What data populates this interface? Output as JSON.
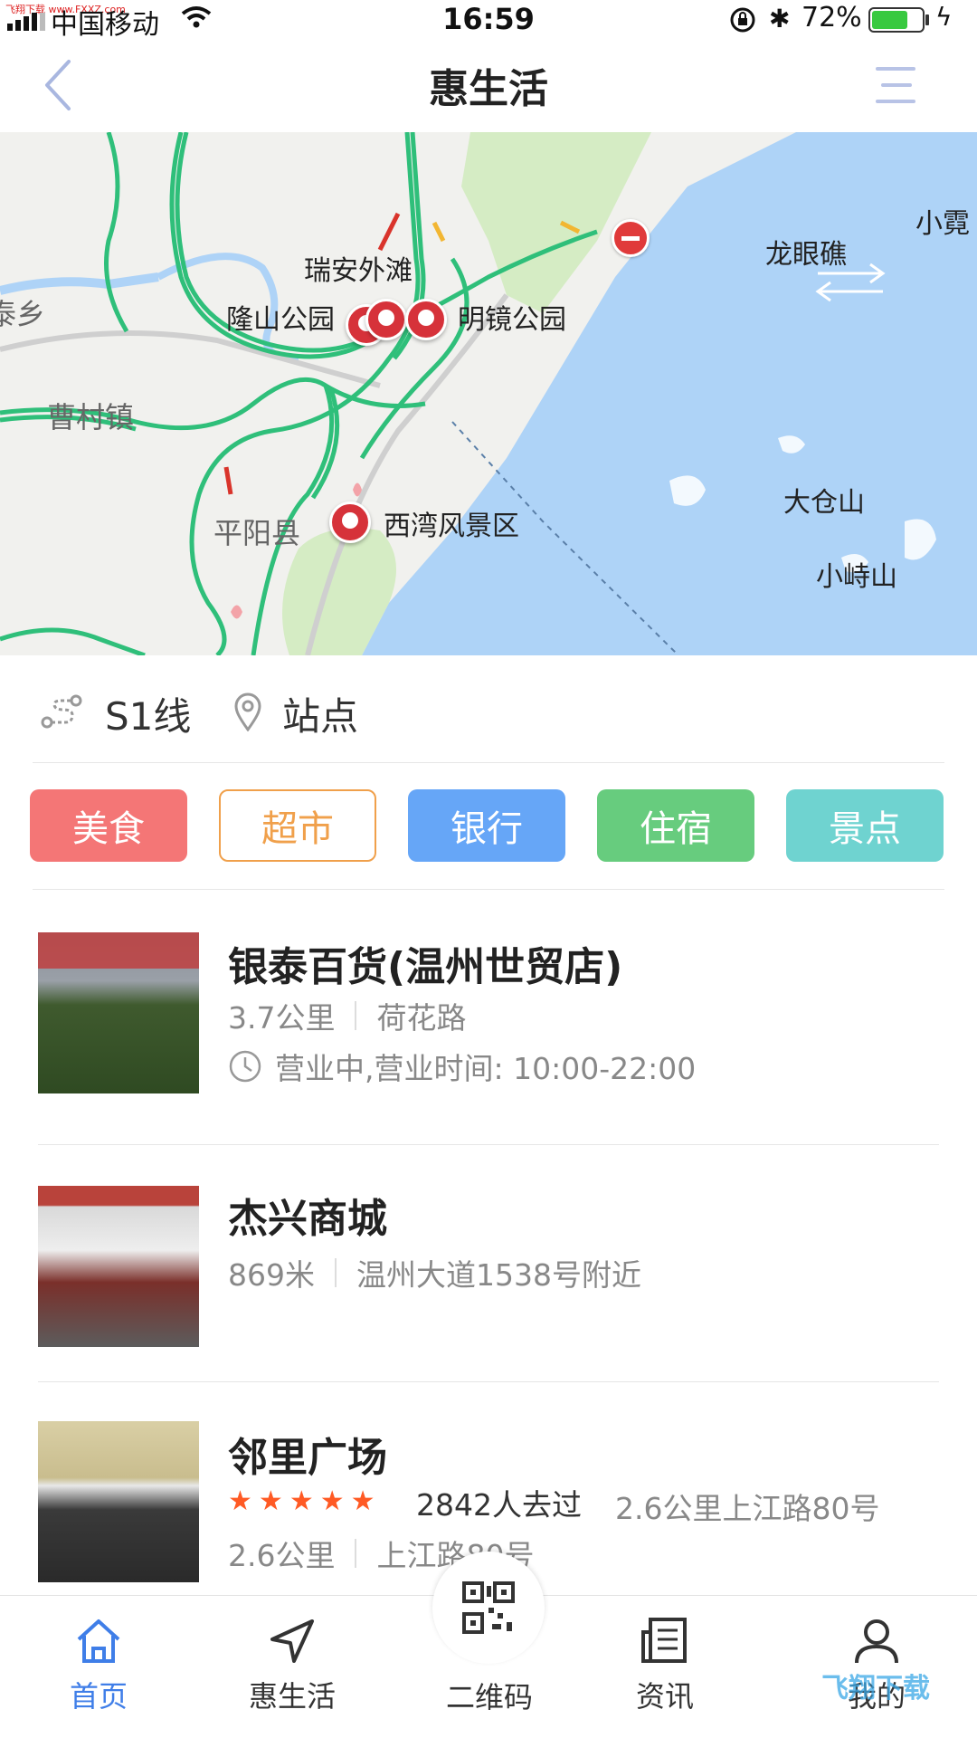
{
  "status_bar": {
    "watermark": "飞翔下载 www.FXXZ.com",
    "carrier": "中国移动",
    "time": "16:59",
    "battery_percent": "72%",
    "battery_level": 0.72
  },
  "nav": {
    "title": "惠生活"
  },
  "map": {
    "labels": {
      "ruian_waitan": "瑞安外滩",
      "longshan_park": "隆山公园",
      "mingjing_park": "明镜公园",
      "caocun_town": "曹村镇",
      "pingyang_county": "平阳县",
      "xiwan_scenic": "西湾风景区",
      "longyanjiao": "龙眼礁",
      "xiaoni": "小霓",
      "dacangshan": "大仓山",
      "xiaoshishan": "小峙山",
      "taixiang": "泰乡"
    }
  },
  "route_row": {
    "line_label": "S1线",
    "station_label": "站点"
  },
  "categories": [
    "美食",
    "超市",
    "银行",
    "住宿",
    "景点"
  ],
  "places": [
    {
      "name": "银泰百货(温州世贸店)",
      "distance": "3.7公里",
      "address": "荷花路",
      "hours": "营业中,营业时间: 10:00-22:00"
    },
    {
      "name": "杰兴商城",
      "distance": "869米",
      "address": "温州大道1538号附近"
    },
    {
      "name": "邻里广场",
      "rating": 5,
      "visits": "2842人去过",
      "distance": "2.6公里",
      "address": "上江路80号",
      "overlap_distance": "2.6公里",
      "overlap_address": "上江路80号"
    }
  ],
  "tabbar": {
    "home": "首页",
    "life": "惠生活",
    "qrcode": "二维码",
    "news": "资讯",
    "mine": "我的",
    "corner_logo": "飞翔下载"
  },
  "colors": {
    "accent_blue": "#3f7ee8",
    "food": "#f47676",
    "market": "#f0a04b",
    "bank": "#66a6f7",
    "hotel": "#67cc7e",
    "scenic": "#6fd3d0",
    "star": "#ff5a24",
    "water": "#aed3f7",
    "road_green": "#2fbf7a"
  },
  "icons": {
    "back": "chevron-left-icon",
    "menu": "list-menu-icon",
    "route": "route-line-icon",
    "station": "location-pin-icon",
    "clock": "clock-icon",
    "home": "home-icon",
    "life": "navigation-arrow-icon",
    "qrcode": "qrcode-icon",
    "news": "newspaper-icon",
    "mine": "user-icon"
  }
}
